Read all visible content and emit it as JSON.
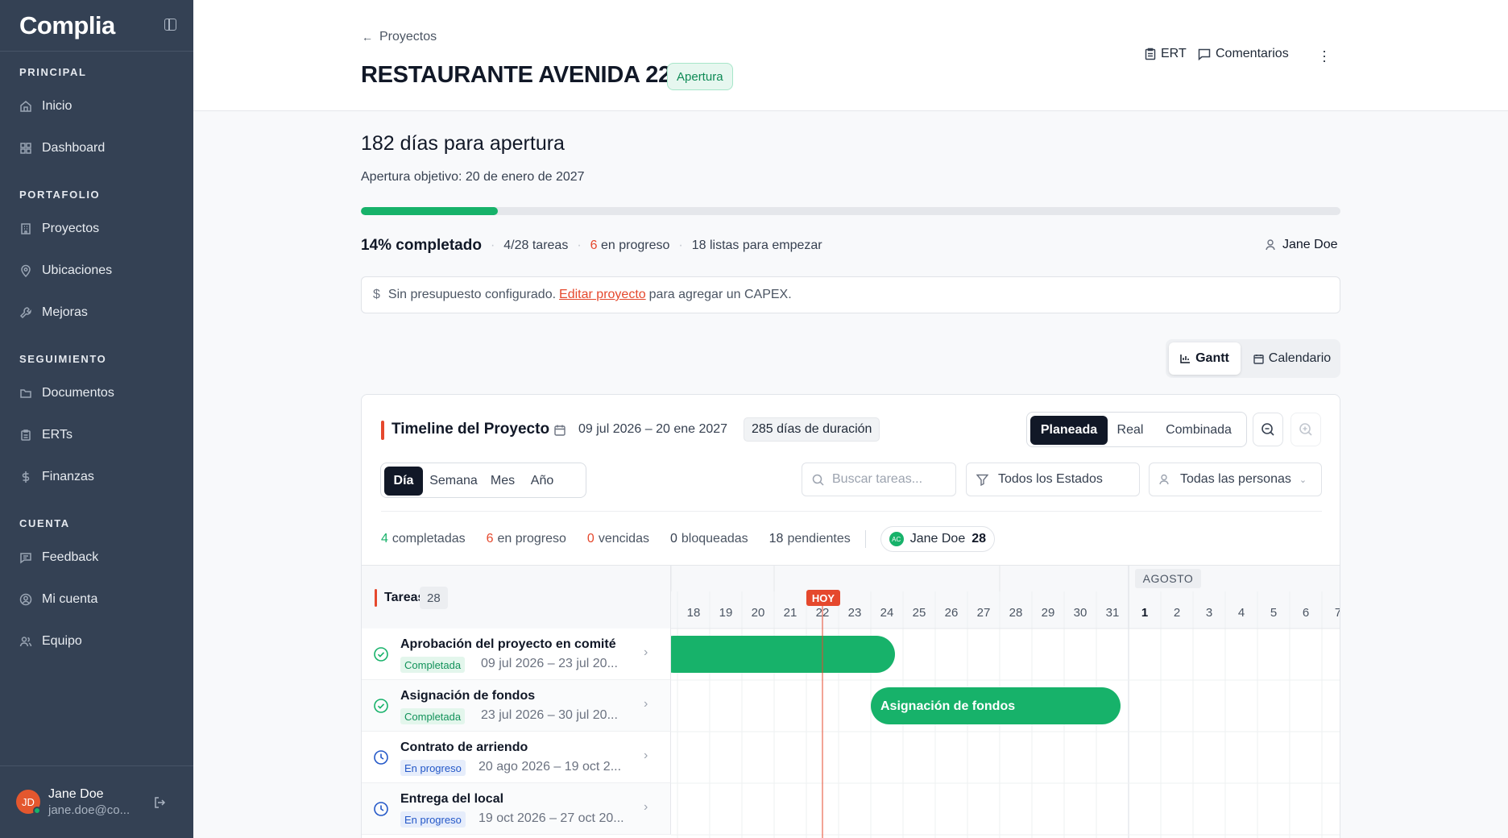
{
  "sidebar": {
    "brand": "Complia",
    "sections": [
      {
        "title": "PRINCIPAL",
        "items": [
          {
            "label": "Inicio",
            "icon": "home-icon"
          },
          {
            "label": "Dashboard",
            "icon": "grid-icon"
          }
        ]
      },
      {
        "title": "PORTAFOLIO",
        "items": [
          {
            "label": "Proyectos",
            "icon": "building-icon"
          },
          {
            "label": "Ubicaciones",
            "icon": "map-pin-icon"
          },
          {
            "label": "Mejoras",
            "icon": "wrench-icon"
          }
        ]
      },
      {
        "title": "SEGUIMIENTO",
        "items": [
          {
            "label": "Documentos",
            "icon": "folder-icon"
          },
          {
            "label": "ERTs",
            "icon": "clipboard-icon"
          },
          {
            "label": "Finanzas",
            "icon": "dollar-icon"
          }
        ]
      },
      {
        "title": "CUENTA",
        "items": [
          {
            "label": "Feedback",
            "icon": "message-icon"
          },
          {
            "label": "Mi cuenta",
            "icon": "user-circle-icon"
          },
          {
            "label": "Equipo",
            "icon": "users-icon"
          }
        ]
      }
    ],
    "user": {
      "initials": "JD",
      "name": "Jane Doe",
      "email": "jane.doe@co..."
    }
  },
  "header": {
    "breadcrumb": "Proyectos",
    "title": "RESTAURANTE AVENIDA 22",
    "status": "Apertura",
    "actions": {
      "ert": "ERT",
      "comments": "Comentarios"
    }
  },
  "summary": {
    "days": "182 días para apertura",
    "target": "Apertura objetivo: 20 de enero de 2027",
    "progress": 0.14,
    "completed": "14% completado",
    "tasks": "4/28 tareas",
    "in_progress_num": "6",
    "in_progress_txt": "en progreso",
    "ready": "18 listas para empezar",
    "owner": "Jane Doe"
  },
  "budget": {
    "pre": "Sin presupuesto configurado.",
    "link": "Editar proyecto",
    "post": "para agregar un CAPEX."
  },
  "views": {
    "gantt": "Gantt",
    "calendar": "Calendario"
  },
  "timeline": {
    "title": "Timeline del Proyecto",
    "range": "09 jul 2026 – 20 ene 2027",
    "duration": "285 días de duración",
    "modes": [
      "Planeada",
      "Real",
      "Combinada"
    ],
    "scales": [
      "Día",
      "Semana",
      "Mes",
      "Año"
    ],
    "search_placeholder": "Buscar tareas...",
    "state_filter": "Todos los Estados",
    "people_filter": "Todas las personas",
    "counts": {
      "completed_n": "4",
      "completed_t": "completadas",
      "progress_n": "6",
      "progress_t": "en progreso",
      "overdue_n": "0",
      "overdue_t": "vencidas",
      "blocked_n": "0",
      "blocked_t": "bloqueadas",
      "pending_n": "18",
      "pending_t": "pendientes"
    },
    "person": {
      "initials": "AC",
      "name": "Jane Doe",
      "count": "28"
    },
    "tasks_label": "Tareas",
    "tasks_count": "28",
    "month": "AGOSTO",
    "today": "HOY",
    "days": [
      "18",
      "19",
      "20",
      "21",
      "22",
      "23",
      "24",
      "25",
      "26",
      "27",
      "28",
      "29",
      "30",
      "31",
      "1",
      "2",
      "3",
      "4",
      "5",
      "6",
      "7"
    ],
    "rows": [
      {
        "name": "Aprobación del proyecto en comité",
        "status": "Completada",
        "kind": "done",
        "dates": "09 jul 2026 – 23 jul 20..."
      },
      {
        "name": "Asignación de fondos",
        "status": "Completada",
        "kind": "done",
        "dates": "23 jul 2026 – 30 jul 20..."
      },
      {
        "name": "Contrato de arriendo",
        "status": "En progreso",
        "kind": "prog",
        "dates": "20 ago 2026 – 19 oct 2..."
      },
      {
        "name": "Entrega del local",
        "status": "En progreso",
        "kind": "prog",
        "dates": "19 oct 2026 – 27 oct 20..."
      }
    ],
    "bars": [
      {
        "label": "",
        "start": "2026-07-09",
        "end": "2026-07-23"
      },
      {
        "label": "Asignación de fondos",
        "start": "2026-07-23",
        "end": "2026-07-30"
      }
    ],
    "colors": {
      "bar": "#17b26a",
      "today": "#e5482d"
    }
  }
}
